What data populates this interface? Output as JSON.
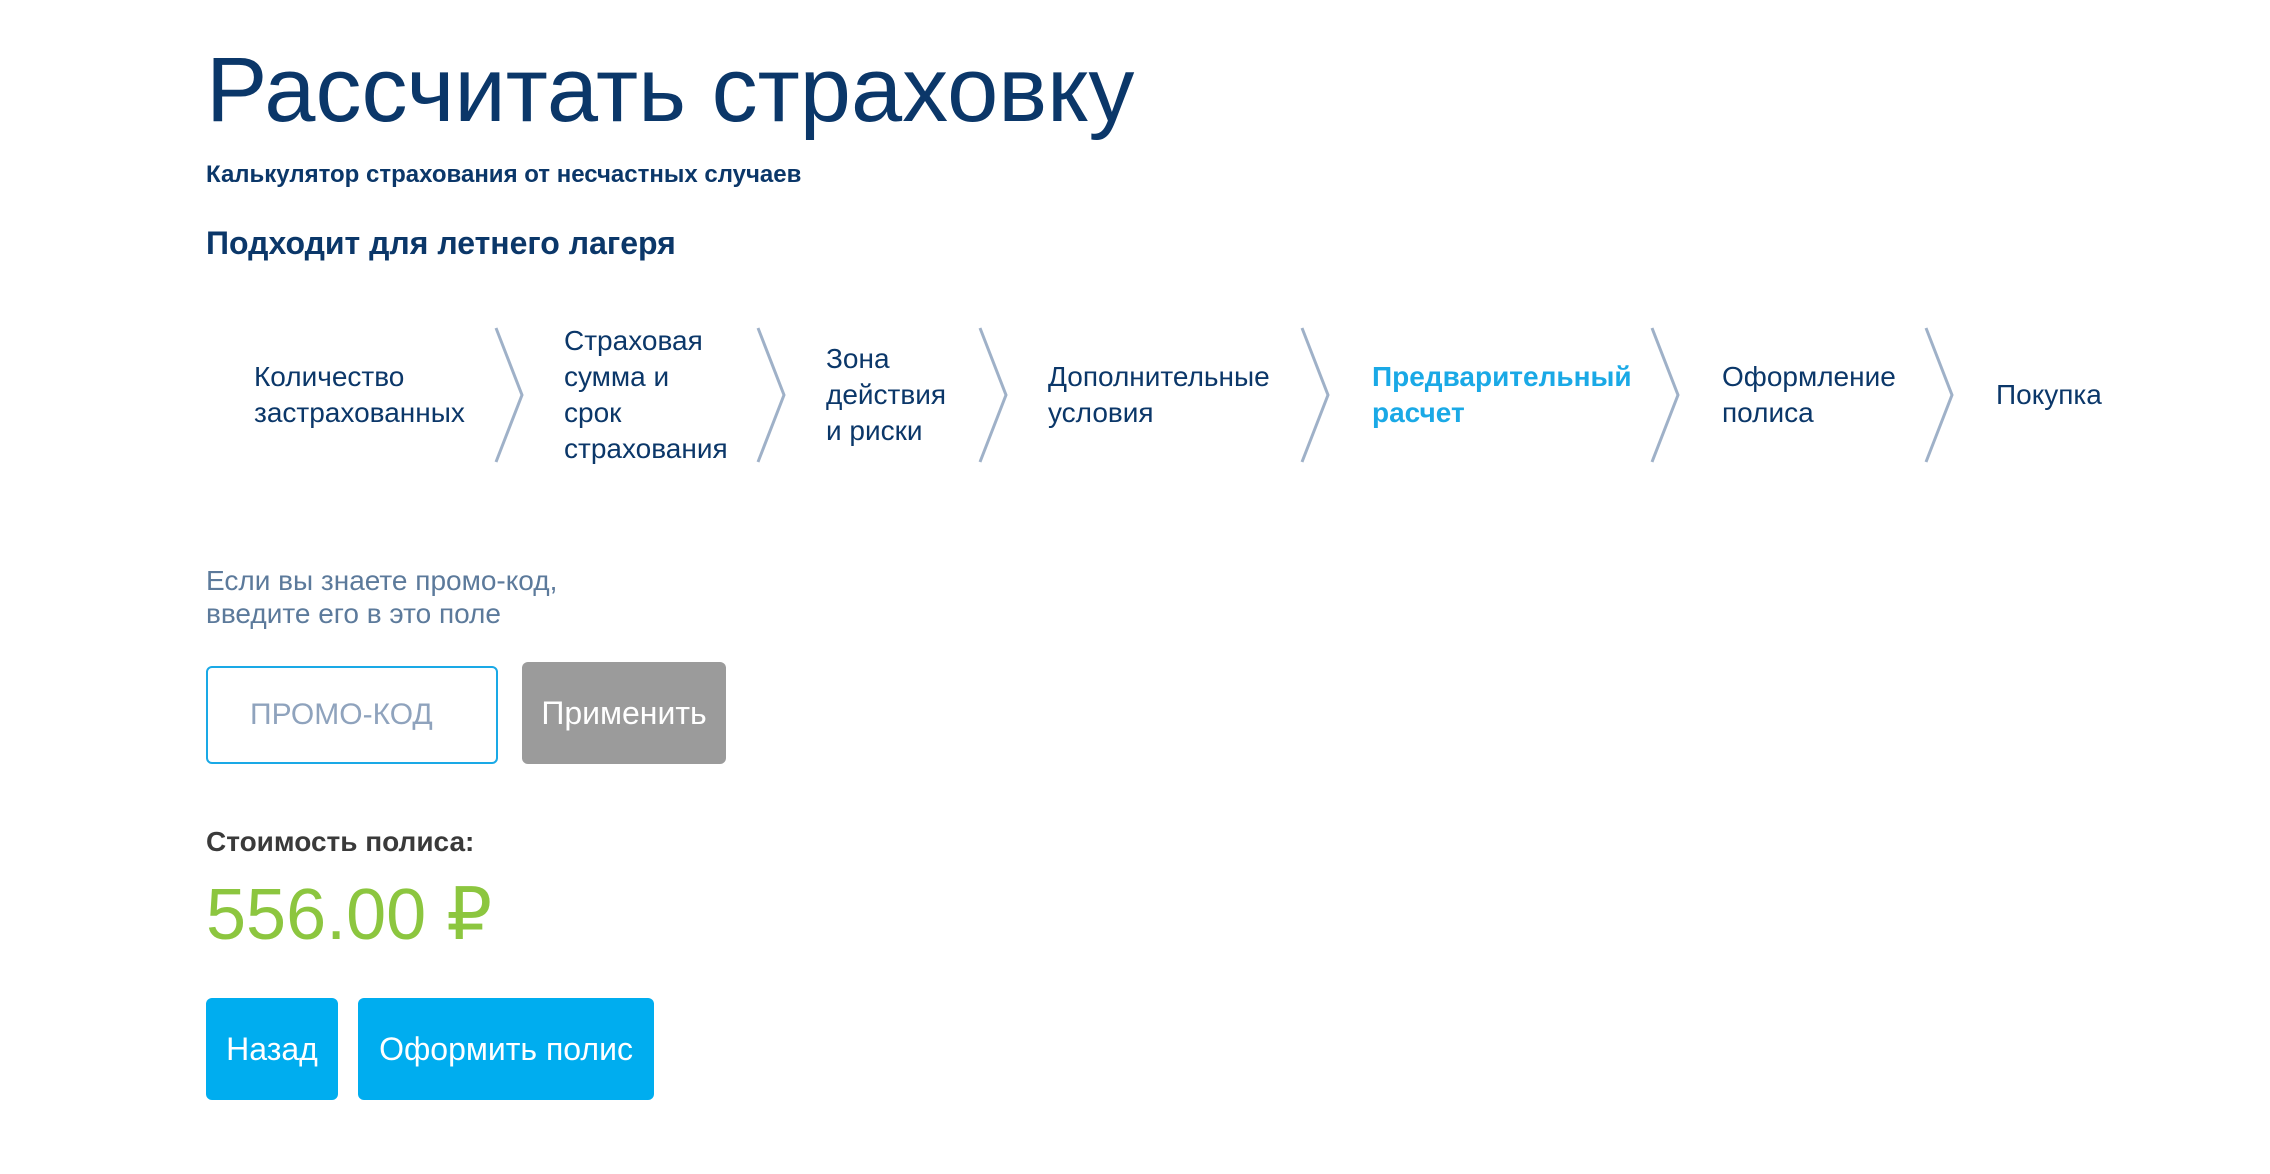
{
  "header": {
    "title": "Рассчитать страховку",
    "subtitle": "Калькулятор страхования от несчастных случаев",
    "tagline": "Подходит для летнего лагеря"
  },
  "steps": [
    {
      "label": "Количество\nзастрахованных",
      "active": false
    },
    {
      "label": "Страховая\nсумма и\nсрок\nстрахования",
      "active": false
    },
    {
      "label": "Зона\nдействия\nи риски",
      "active": false
    },
    {
      "label": "Дополнительные\nусловия",
      "active": false
    },
    {
      "label": "Предварительный\nрасчет",
      "active": true
    },
    {
      "label": "Оформление\nполиса",
      "active": false
    },
    {
      "label": "Покупка",
      "active": false
    }
  ],
  "promo": {
    "hint": "Если вы знаете промо-код,\nвведите его в это поле",
    "placeholder": "ПРОМО-КОД",
    "value": "",
    "apply_label": "Применить"
  },
  "price": {
    "label": "Стоимость полиса:",
    "value": "556.00 ₽"
  },
  "actions": {
    "back_label": "Назад",
    "issue_label": "Оформить полис"
  },
  "colors": {
    "heading": "#0b3769",
    "accent": "#1aa9e6",
    "button": "#00adef",
    "price": "#8cc63f",
    "disabled": "#9b9b9b"
  }
}
